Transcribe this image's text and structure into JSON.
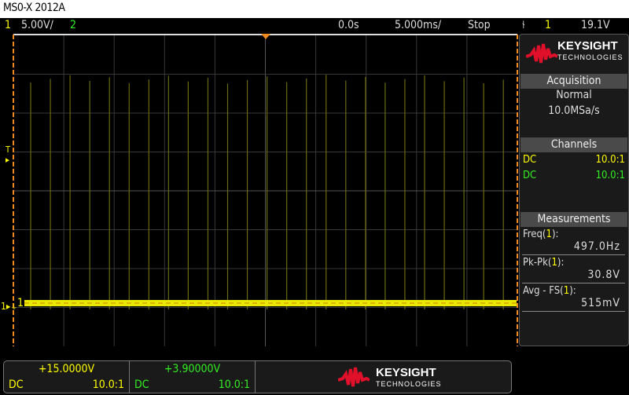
{
  "title": "MS0-X 2012A",
  "topbar": {
    "ch1_num": "1",
    "ch1_scale": "5.00V/",
    "ch2_num": "2",
    "delay": "0.0s",
    "timebase": "5.000ms/",
    "run_state": "Stop",
    "trigger_edge_icon": "rising-edge-icon",
    "trigger_source": "1",
    "trigger_level": "19.1V"
  },
  "markers": {
    "trigger_level": "T",
    "ch1_ground": "1"
  },
  "colors": {
    "ch1": "#ffff00",
    "ch2": "#33ee22",
    "accent": "#f08a20",
    "brand": "#e0102a"
  },
  "panel": {
    "logo": {
      "name": "KEYSIGHT",
      "sub": "TECHNOLOGIES"
    },
    "acquisition": {
      "header": "Acquisition",
      "mode": "Normal",
      "rate": "10.0MSa/s"
    },
    "channels": {
      "header": "Channels",
      "items": [
        {
          "coupling": "DC",
          "probe": "10.0:1"
        },
        {
          "coupling": "DC",
          "probe": "10.0:1"
        }
      ]
    },
    "measurements": {
      "header": "Measurements",
      "items": [
        {
          "label": "Freq(",
          "src": "1",
          "end": "):",
          "value": "497.0Hz"
        },
        {
          "label": "Pk-Pk(",
          "src": "1",
          "end": "):",
          "value": "30.8V"
        },
        {
          "label": "Avg - FS(",
          "src": "1",
          "end": "):",
          "value": "515mV"
        }
      ]
    }
  },
  "bottom": {
    "ch1": {
      "offset": "+15.0000V",
      "coupling": "DC",
      "probe": "10.0:1"
    },
    "ch2": {
      "offset": "+3.90000V",
      "coupling": "DC",
      "probe": "10.0:1"
    }
  }
}
